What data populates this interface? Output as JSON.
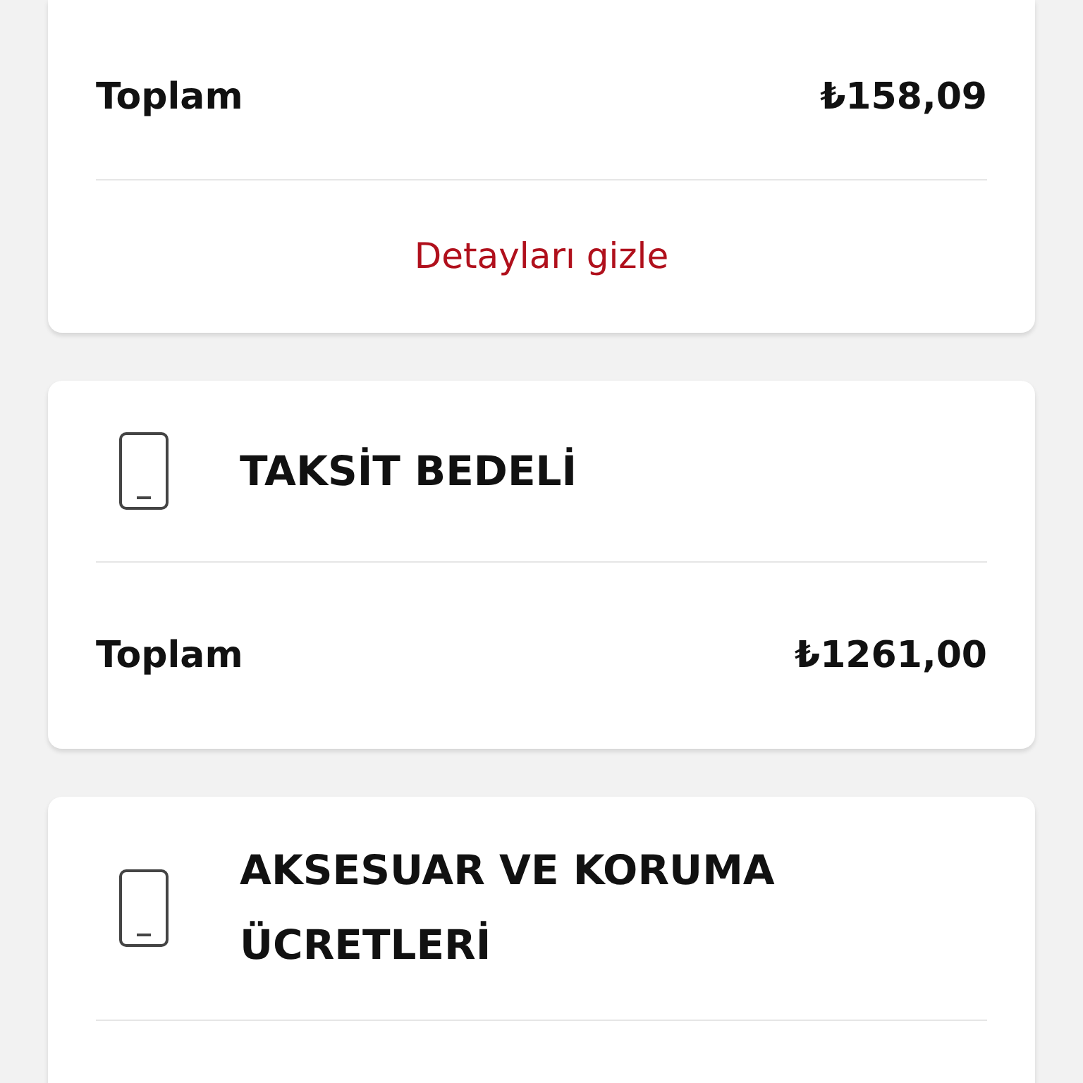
{
  "cards": [
    {
      "total": {
        "label": "Toplam",
        "value": "₺158,09"
      },
      "link": "Detayları gizle"
    },
    {
      "header": {
        "title": "TAKSİT BEDELİ"
      },
      "total": {
        "label": "Toplam",
        "value": "₺1261,00"
      }
    },
    {
      "header": {
        "title": "AKSESUAR VE KORUMA ÜCRETLERİ"
      }
    }
  ]
}
